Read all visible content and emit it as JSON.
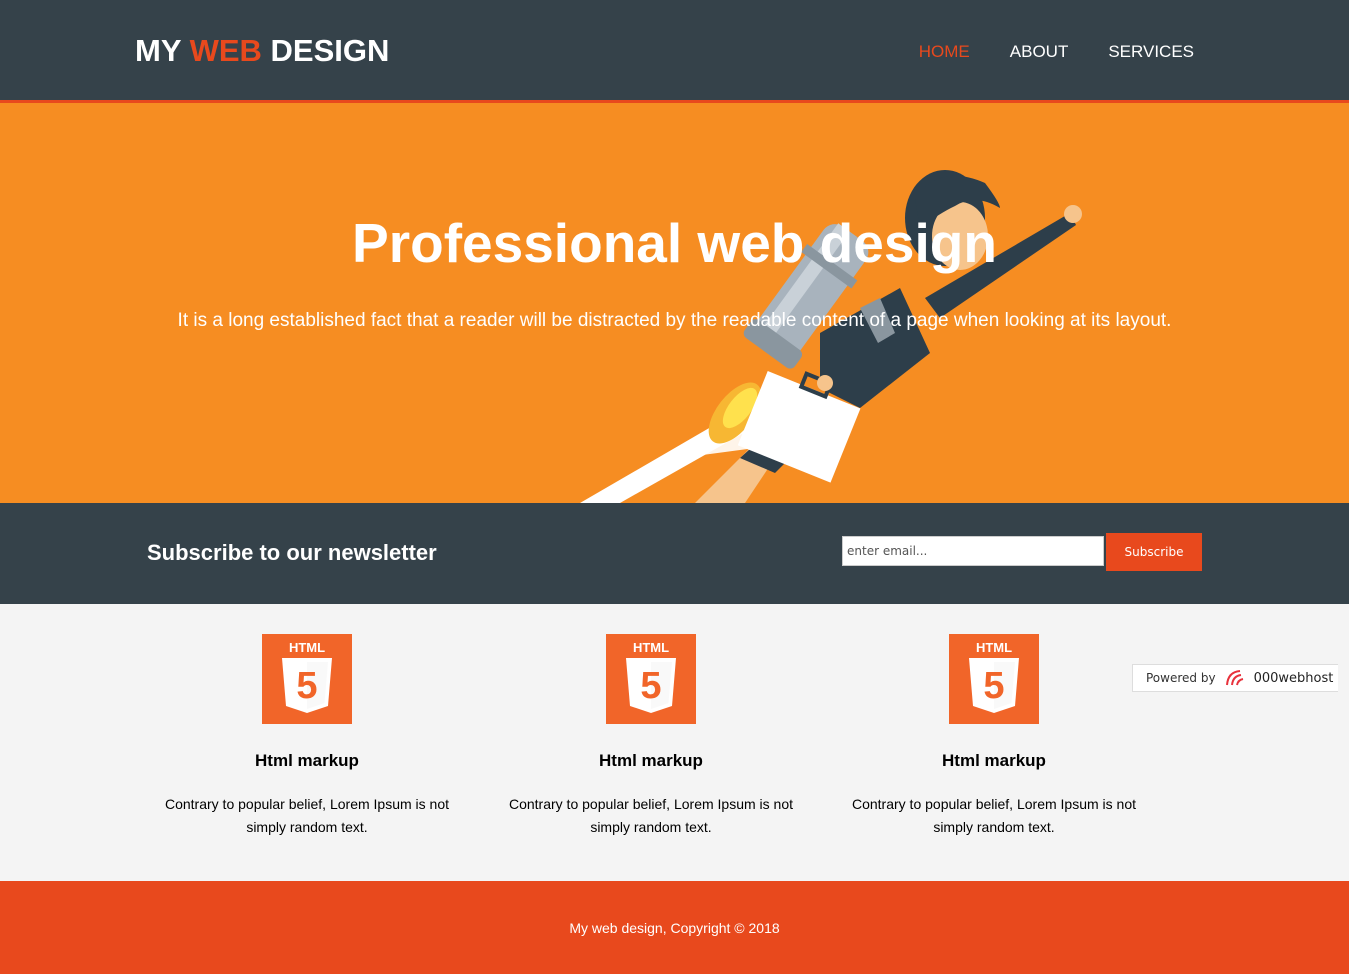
{
  "colors": {
    "header_bg": "#35424a",
    "accent": "#e8491d",
    "showcase_bg": "#f68d22",
    "section_bg": "#f4f4f4",
    "html5_badge": "#f16529"
  },
  "header": {
    "logo_prefix": "MY ",
    "logo_highlight": "WEB",
    "logo_suffix": " DESIGN",
    "nav": [
      {
        "label": "HOME",
        "active": true
      },
      {
        "label": "ABOUT",
        "active": false
      },
      {
        "label": "SERVICES",
        "active": false
      }
    ]
  },
  "showcase": {
    "title": "Professional web design",
    "text": "It is a long established fact that a reader will be distracted by the readable content of a page when looking at its layout.",
    "illustration": "jetpack-businesswoman"
  },
  "newsletter": {
    "heading": "Subscribe to our newsletter",
    "email_placeholder": "enter email...",
    "button_label": "Subscribe"
  },
  "boxes": [
    {
      "icon": "html5-icon",
      "badge_text": "HTML",
      "number": "5",
      "title": "Html markup",
      "text": "Contrary to popular belief, Lorem Ipsum is not simply random text."
    },
    {
      "icon": "html5-icon",
      "badge_text": "HTML",
      "number": "5",
      "title": "Html markup",
      "text": "Contrary to popular belief, Lorem Ipsum is not simply random text."
    },
    {
      "icon": "html5-icon",
      "badge_text": "HTML",
      "number": "5",
      "title": "Html markup",
      "text": "Contrary to popular belief, Lorem Ipsum is not simply random text."
    }
  ],
  "powered_badge": {
    "prefix": "Powered by",
    "brand": "000webhost"
  },
  "footer": {
    "text": "My web design, Copyright © 2018"
  }
}
